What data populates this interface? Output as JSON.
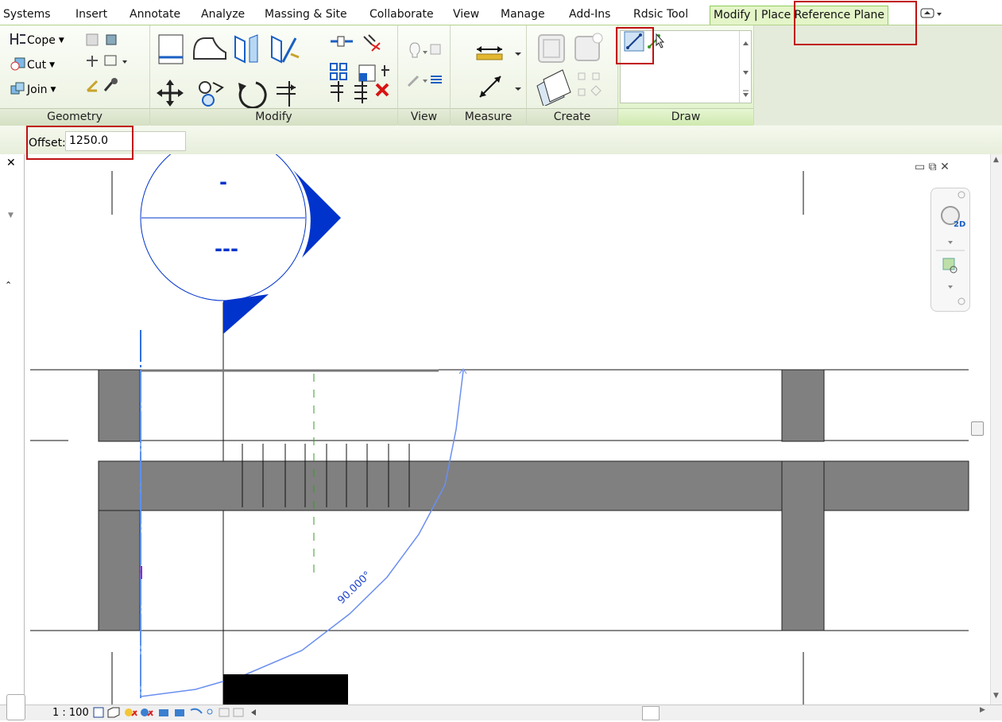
{
  "tabs": [
    "Systems",
    "Insert",
    "Annotate",
    "Analyze",
    "Massing & Site",
    "Collaborate",
    "View",
    "Manage",
    "Add-Ins",
    "Rdsic Tool",
    "Modify | Place Reference Plane"
  ],
  "ribbon": {
    "geometry": {
      "cope": "Cope",
      "cut": "Cut",
      "join": "Join"
    },
    "panels": {
      "geometry": "Geometry",
      "modify": "Modify",
      "view": "View",
      "measure": "Measure",
      "create": "Create",
      "draw": "Draw"
    }
  },
  "options": {
    "offset_label": "Offset:",
    "offset_value": "1250.0"
  },
  "canvas": {
    "angle_label": "90.000°",
    "tag_top": "-",
    "tag_bottom": "---"
  },
  "status": {
    "scale": "1 : 100"
  },
  "colors": {
    "accent": "#0033cc",
    "highlight": "#c01010",
    "ribbon_active": "#e4f5c8"
  },
  "icons": [
    "cope-icon",
    "cut-icon",
    "join-icon",
    "align-icon",
    "move-icon",
    "rotate-icon",
    "mirror-icon",
    "delete-icon",
    "aligned-dimension-icon",
    "line-draw-icon",
    "pick-line-icon",
    "view-cube-icon",
    "zoom-icon"
  ]
}
